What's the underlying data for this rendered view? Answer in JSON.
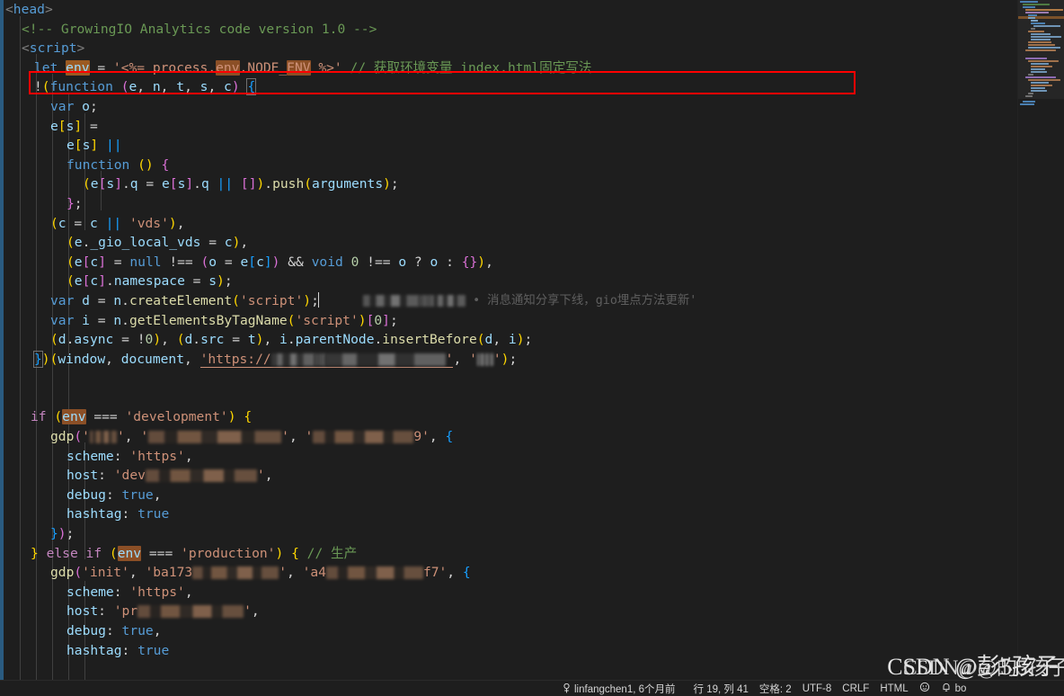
{
  "window": {
    "app": "Visual Studio Code",
    "language_mode": "HTML",
    "theme": "Dark+"
  },
  "editor": {
    "filename_context": "index.html",
    "code_lines": [
      {
        "indent": 0,
        "text": "<head>"
      },
      {
        "indent": 1,
        "text": "<!-- GrowingIO Analytics code version 1.0 -->"
      },
      {
        "indent": 1,
        "text": "<script>"
      },
      {
        "indent": 2,
        "text": "let env = '<%= process.env.NODE_ENV %>' // 获取环境变量 index.html固定写法"
      },
      {
        "indent": 2,
        "text": "!(function (e, n, t, s, c) {"
      },
      {
        "indent": 3,
        "text": "var o;"
      },
      {
        "indent": 3,
        "text": "e[s] ="
      },
      {
        "indent": 4,
        "text": "e[s] ||"
      },
      {
        "indent": 4,
        "text": "function () {"
      },
      {
        "indent": 5,
        "text": "(e[s].q = e[s].q || []).push(arguments);"
      },
      {
        "indent": 4,
        "text": "};"
      },
      {
        "indent": 3,
        "text": "(c = c || 'vds'),"
      },
      {
        "indent": 4,
        "text": "(e._gio_local_vds = c),"
      },
      {
        "indent": 4,
        "text": "(e[c] = null !== (o = e[c]) && void 0 !== o ? o : {}),"
      },
      {
        "indent": 4,
        "text": "(e[c].namespace = s);"
      },
      {
        "indent": 3,
        "text": "var d = n.createElement('script');"
      },
      {
        "indent": 3,
        "text": "var i = n.getElementsByTagName('script')[0];"
      },
      {
        "indent": 3,
        "text": "(d.async = !0), (d.src = t), i.parentNode.insertBefore(d, i);"
      },
      {
        "indent": 2,
        "text": "})(window, document, 'https://██████', '██');"
      },
      {
        "indent": 0,
        "text": ""
      },
      {
        "indent": 0,
        "text": ""
      },
      {
        "indent": 2,
        "text": "if (env === 'development') {"
      },
      {
        "indent": 3,
        "text": "gdp('███', '█████████', '█████9', {"
      },
      {
        "indent": 4,
        "text": "scheme: 'https',"
      },
      {
        "indent": 4,
        "text": "host: 'dev███████',"
      },
      {
        "indent": 4,
        "text": "debug: true,"
      },
      {
        "indent": 4,
        "text": "hashtag: true"
      },
      {
        "indent": 3,
        "text": "});"
      },
      {
        "indent": 2,
        "text": "} else if (env === 'production') { // 生产"
      },
      {
        "indent": 3,
        "text": "gdp('init', 'ba173█████', 'a4██████f7', {"
      },
      {
        "indent": 4,
        "text": "scheme: 'https',"
      },
      {
        "indent": 4,
        "text": "host: 'pr███████',"
      },
      {
        "indent": 4,
        "text": "debug: true,"
      },
      {
        "indent": 4,
        "text": "hashtag: true"
      }
    ],
    "highlighted_line_number": 19,
    "highlight_box_color": "#ff0000",
    "occurrence_highlight_token": "env",
    "occurrence_highlight_color": "#8b4f26",
    "git_blame_annotation": "• 消息通知分享下线，gio埋点方法更新'"
  },
  "status_bar": {
    "author_icon": "account-icon",
    "author": "linfangchen1, 6个月前",
    "cursor_position": "行 19, 列 41",
    "indentation": "空格: 2",
    "encoding": "UTF-8",
    "eol": "CRLF",
    "language": "HTML",
    "notifications_icon": "bell-icon",
    "smile_icon": "feedback-icon",
    "extra_label": "bo"
  },
  "watermark": {
    "text": "CSDN @彭5孩子",
    "overlay_text": "CSDN@@的5孩子"
  },
  "minimap": {
    "name": "minimap",
    "slider_visible": true
  }
}
